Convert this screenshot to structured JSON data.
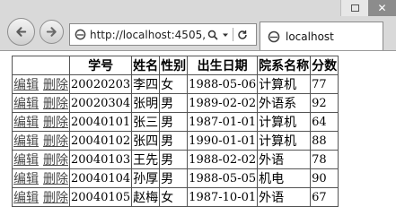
{
  "browser": {
    "url": "http://localhost:4505,",
    "tab_title": "localhost",
    "search_icon": "search-icon",
    "dropdown_icon": "chevron-down-icon",
    "refresh_icon": "refresh-icon",
    "close_glyph": "✕"
  },
  "table": {
    "headers": [
      "",
      "学号",
      "姓名",
      "性别",
      "出生日期",
      "院系名称",
      "分数"
    ],
    "edit_label": "编辑",
    "delete_label": "删除",
    "rows": [
      {
        "id": "20020203",
        "name": "李四",
        "gender": "女",
        "birth": "1988-05-06",
        "dept": "计算机",
        "score": "77"
      },
      {
        "id": "20020304",
        "name": "张明",
        "gender": "男",
        "birth": "1989-02-02",
        "dept": "外语系",
        "score": "92"
      },
      {
        "id": "20040101",
        "name": "张三",
        "gender": "男",
        "birth": "1987-01-01",
        "dept": "计算机",
        "score": "64"
      },
      {
        "id": "20040102",
        "name": "张四",
        "gender": "男",
        "birth": "1990-01-01",
        "dept": "计算机",
        "score": "88"
      },
      {
        "id": "20040103",
        "name": "王先",
        "gender": "男",
        "birth": "1988-02-02",
        "dept": "外语",
        "score": "78"
      },
      {
        "id": "20040104",
        "name": "孙厚",
        "gender": "男",
        "birth": "1988-05-05",
        "dept": "机电",
        "score": "90"
      },
      {
        "id": "20040105",
        "name": "赵梅",
        "gender": "女",
        "birth": "1987-10-01",
        "dept": "外语",
        "score": "67"
      }
    ]
  }
}
